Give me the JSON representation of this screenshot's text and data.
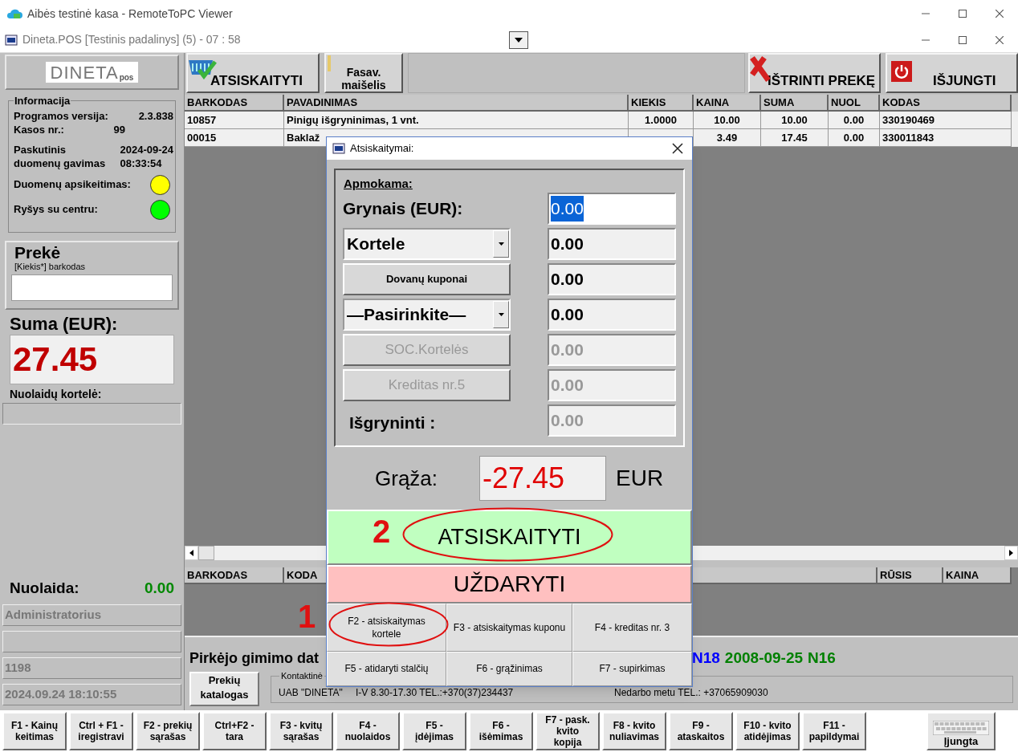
{
  "app_window": {
    "title": "Aibės testinė kasa - RemoteToPC Viewer"
  },
  "pos_window": {
    "title": "Dineta.POS [Testinis padalinys] (5) - 07 : 58"
  },
  "logo": {
    "text": "DINETA",
    "suffix": "pos"
  },
  "info": {
    "title": "Informacija",
    "rows": [
      {
        "label": "Programos versija:",
        "value": "2.3.838"
      },
      {
        "label": "Kasos nr.:",
        "value": "99"
      },
      {
        "label": "Paskutinis\nduomenų gavimas",
        "value": "2024-09-24\n08:33:54"
      }
    ],
    "indicators": [
      {
        "label": "Duomenų apsikeitimas:",
        "color": "#ffff00"
      },
      {
        "label": "Ryšys su centru:",
        "color": "#00ff00"
      }
    ]
  },
  "item_entry": {
    "title": "Prekė",
    "hint": "[Kiekis*] barkodas"
  },
  "sum": {
    "label": "Suma (EUR):",
    "value": "27.45"
  },
  "discount_card": {
    "label": "Nuolaidų kortelė:"
  },
  "discount": {
    "label": "Nuolaida:",
    "value": "0.00"
  },
  "status_fields": [
    {
      "kind": "text",
      "value": "Administratorius"
    },
    {
      "kind": "blank"
    },
    {
      "kind": "text",
      "value": "1198"
    },
    {
      "kind": "text",
      "value": "2024.09.24 18:10:55"
    }
  ],
  "toolbar_left": [
    {
      "kind": "pay",
      "label": "ATSISKAITYTI"
    },
    {
      "kind": "bag",
      "label": "Fasav.\nmaišelis"
    }
  ],
  "toolbar_right": [
    {
      "kind": "delete",
      "label": "IŠTRINTI PREKĘ"
    },
    {
      "kind": "power",
      "label": "IŠJUNGTI"
    }
  ],
  "items_table": {
    "columns": [
      "BARKODAS",
      "PAVADINIMAS",
      "KIEKIS",
      "KAINA",
      "SUMA",
      "NUOL",
      "KODAS"
    ],
    "rows": [
      [
        "10857",
        "Pinigų išgryninimas, 1 vnt.",
        "1.0000",
        "10.00",
        "10.00",
        "0.00",
        "330190469"
      ],
      [
        "00015",
        "Baklaž",
        null,
        "3.49",
        "17.45",
        "0.00",
        "330011843"
      ]
    ]
  },
  "lower_table": {
    "columns": [
      "BARKODAS",
      "KODA",
      null,
      "RŪSIS",
      "KAINA"
    ]
  },
  "customer": {
    "label": "Pirkėjo gimimo dat",
    "codes": [
      {
        "text": "N18",
        "color": "#0000ff"
      },
      {
        "text": "2008-09-25",
        "color": "#008000"
      },
      {
        "text": "N16",
        "color": "#008000"
      }
    ]
  },
  "catalog_button": {
    "label": "Prekių\nkatalogas"
  },
  "contact": {
    "title": "Kontaktinė",
    "company": "UAB \"DINETA\"",
    "hours": "I-V 8.30-17.30 TEL.:+370(37)234437",
    "after_hours": "Nedarbo metu TEL.: +37065909030"
  },
  "function_keys": [
    "F1 - Kainų\nkeitimas",
    "Ctrl + F1 -\niregistravi",
    "F2 - prekių\nsąrašas",
    "Ctrl+F2 -\ntara",
    "F3 - kvitų\nsąrašas",
    "F4 -\nnuolaidos",
    "F5 -\nįdėjimas",
    "F6 -\nišėmimas",
    "F7 - pask.\nkvito\nkopija",
    "F8 - kvito\nnuliavimas",
    "F9 -\nataskaitos",
    "F10 - kvito\natidėjimas",
    "F11 -\npapildymai"
  ],
  "keyboard_button": {
    "label": "Įjungta"
  },
  "payment_dialog": {
    "title": "Atsiskaitymai:",
    "section": "Apmokama:",
    "cash": {
      "label": "Grynais (EUR):",
      "value": "0.00",
      "text_selected": true
    },
    "rows": [
      {
        "kind": "select",
        "label": "Kortele",
        "value": "0.00",
        "disabled": false
      },
      {
        "kind": "button",
        "label": "Dovanų kuponai",
        "value": "0.00",
        "disabled": false
      },
      {
        "kind": "select",
        "label": "—Pasirinkite—",
        "value": "0.00",
        "disabled": false
      },
      {
        "kind": "button",
        "label": "SOC.Kortelės",
        "value": "0.00",
        "disabled": true
      },
      {
        "kind": "button",
        "label": "Kreditas nr.5",
        "value": "0.00",
        "disabled": true
      }
    ],
    "cashout": {
      "label": "Išgryninti :",
      "value": "0.00"
    },
    "change": {
      "label": "Grąža:",
      "value": "-27.45",
      "currency": "EUR"
    },
    "pay_button": "ATSISKAITYTI",
    "close_button": "UŽDARYTI",
    "shortcuts": [
      "F2 - atsiskaitymas\nkortele",
      "F3 - atsiskaitymas kuponu",
      "F4 - kreditas nr. 3",
      "F5 - atidaryti stalčių",
      "F6 - grąžinimas",
      "F7 - supirkimas"
    ]
  },
  "annotations": [
    {
      "label": "1"
    },
    {
      "label": "2"
    }
  ]
}
